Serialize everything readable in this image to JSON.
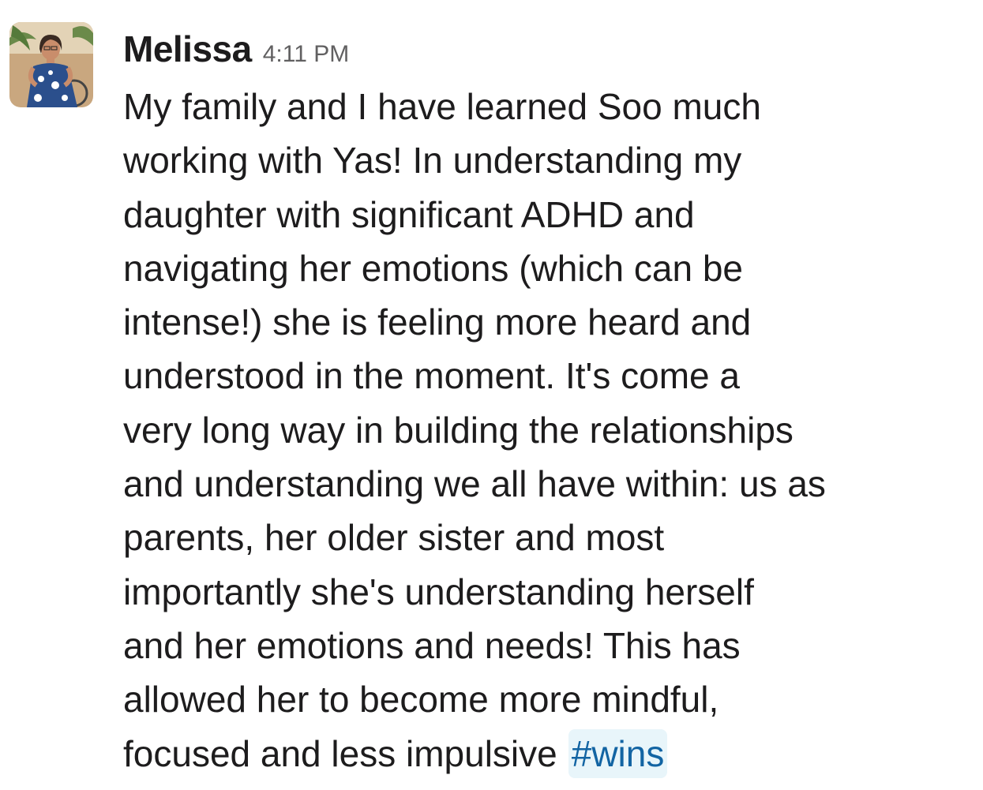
{
  "message": {
    "author": "Melissa",
    "timestamp": "4:11 PM",
    "avatar_icon": "user-avatar-photo",
    "lines": [
      "My family and I have learned Soo much",
      "working with Yas! In understanding my",
      "daughter with significant ADHD and",
      "navigating her emotions (which can be",
      "intense!) she is feeling more heard and",
      "understood in the moment. It's come a",
      "very long way in building the relationships",
      "and understanding we all have within: us as",
      "parents, her older sister and most",
      "importantly she's understanding herself",
      "and her emotions and needs! This has",
      "allowed her to become more mindful,",
      "focused and less impulsive"
    ],
    "hashtag": "#wins",
    "colors": {
      "text": "#1d1c1d",
      "timestamp": "#616061",
      "hashtag_text": "#1264a3",
      "hashtag_bg": "#e8f5fa"
    }
  }
}
